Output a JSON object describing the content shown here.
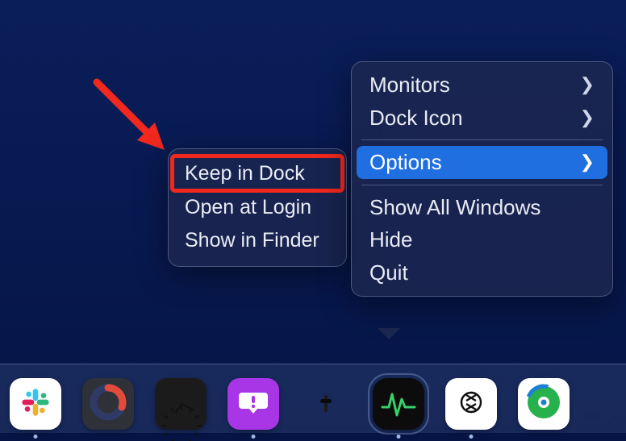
{
  "annotation": {
    "arrow_color": "#f0281e",
    "highlight_target": "Keep in Dock"
  },
  "submenu": {
    "items": [
      {
        "label": "Keep in Dock"
      },
      {
        "label": "Open at Login"
      },
      {
        "label": "Show in Finder"
      }
    ]
  },
  "mainmenu": {
    "groups": [
      [
        {
          "label": "Monitors",
          "has_submenu": true
        },
        {
          "label": "Dock Icon",
          "has_submenu": true
        }
      ],
      [
        {
          "label": "Options",
          "has_submenu": true,
          "selected": true
        }
      ],
      [
        {
          "label": "Show All Windows"
        },
        {
          "label": "Hide"
        },
        {
          "label": "Quit"
        }
      ]
    ]
  },
  "dock": {
    "items": [
      {
        "name": "Slack",
        "icon": "slack-icon",
        "running": true
      },
      {
        "name": "Ring",
        "icon": "ring-icon",
        "running": false
      },
      {
        "name": "Clock",
        "icon": "clock-icon",
        "running": false
      },
      {
        "name": "Feedback Assistant",
        "icon": "feedback-icon",
        "running": true
      },
      {
        "name": "iPhone Mirroring",
        "icon": "phone-icon",
        "running": false
      },
      {
        "name": "Activity Monitor",
        "icon": "activity-icon",
        "running": true,
        "context_open": true
      },
      {
        "name": "ChatGPT",
        "icon": "openai-icon",
        "running": true
      },
      {
        "name": "Find My",
        "icon": "findmy-icon",
        "running": false
      }
    ]
  }
}
